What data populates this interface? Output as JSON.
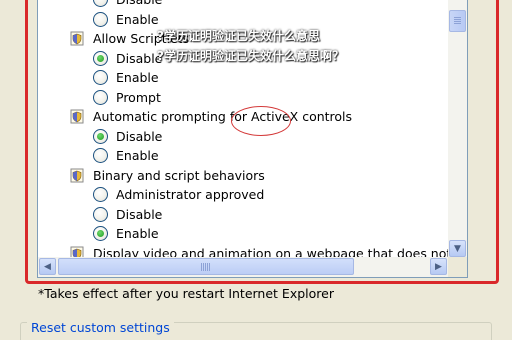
{
  "settings_list": {
    "rows": [
      {
        "kind": "option",
        "label": "Disable",
        "checked": false
      },
      {
        "kind": "option",
        "label": "Enable",
        "checked": false
      },
      {
        "kind": "setting",
        "label": "Allow Scriptlets",
        "icon": "security-setting-icon"
      },
      {
        "kind": "option",
        "label": "Disable",
        "checked": true
      },
      {
        "kind": "option",
        "label": "Enable",
        "checked": false
      },
      {
        "kind": "option",
        "label": "Prompt",
        "checked": false
      },
      {
        "kind": "setting",
        "label": "Automatic prompting for ActiveX controls",
        "icon": "security-setting-icon"
      },
      {
        "kind": "option",
        "label": "Disable",
        "checked": true
      },
      {
        "kind": "option",
        "label": "Enable",
        "checked": false
      },
      {
        "kind": "setting",
        "label": "Binary and script behaviors",
        "icon": "security-setting-icon"
      },
      {
        "kind": "option",
        "label": "Administrator approved",
        "checked": false
      },
      {
        "kind": "option",
        "label": "Disable",
        "checked": false
      },
      {
        "kind": "option",
        "label": "Enable",
        "checked": true
      },
      {
        "kind": "setting",
        "label": "Display video and animation on a webpage that does not use",
        "icon": "security-setting-icon"
      }
    ]
  },
  "scrollbars": {
    "vertical_up_glyph": "▲",
    "vertical_down_glyph": "▼",
    "horizontal_left_glyph": "◀",
    "horizontal_right_glyph": "▶"
  },
  "restart_note": "*Takes effect after you restart Internet Explorer",
  "reset_group_title": "Reset custom settings",
  "overlay": {
    "line1": "?学历证明验证已失效什么意思",
    "line2": "?学历证明验证已失效什么意思啊？"
  },
  "colors": {
    "highlight_frame": "#d9282a",
    "annotation_circle": "#d43a3a",
    "link_blue": "#0046d5"
  }
}
